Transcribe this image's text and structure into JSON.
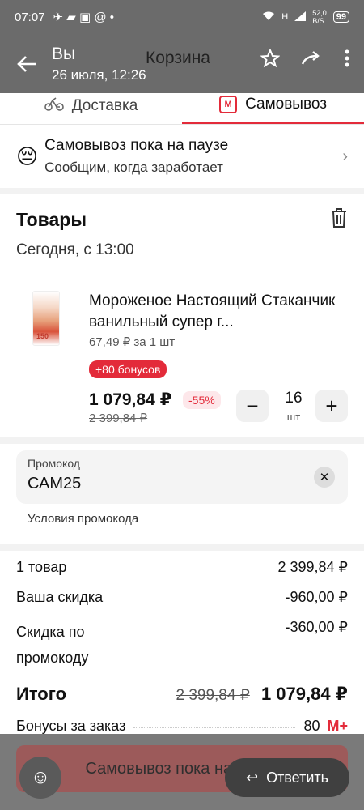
{
  "status_bar": {
    "time": "07:07",
    "net_speed_top": "52,0",
    "net_speed_bottom": "B/S",
    "battery": "99",
    "signal_label": "H"
  },
  "header": {
    "author": "Вы",
    "datetime": "26 июля, 12:26",
    "title": "Корзина"
  },
  "tabs": [
    {
      "label": "Доставка",
      "icon": "bicycle-icon"
    },
    {
      "label": "Самовывоз",
      "icon": "magnit-store-icon",
      "pill": "M"
    }
  ],
  "pause_notice": {
    "emoji": "😔",
    "title": "Самовывоз пока на паузе",
    "subtitle": "Сообщим, когда заработает"
  },
  "goods": {
    "title": "Товары",
    "time": "Сегодня, с 13:00",
    "item": {
      "name": "Мороженое Настоящий Стаканчик ванильный супер г...",
      "unit_price": "67,49 ₽ за 1 шт",
      "bonus": "+80 бонусов",
      "price": "1 079,84 ₽",
      "discount": "-55%",
      "old_price": "2 399,84 ₽",
      "qty": "16",
      "qty_unit": "шт",
      "thumb_label": "150"
    }
  },
  "promo": {
    "label": "Промокод",
    "value": "САМ25",
    "conditions": "Условия промокода"
  },
  "summary": {
    "rows": [
      {
        "label": "1 товар",
        "value": "2 399,84 ₽"
      },
      {
        "label": "Ваша скидка",
        "value": "-960,00 ₽"
      },
      {
        "label": "Скидка по промокоду",
        "value": "-360,00 ₽"
      }
    ],
    "total_label": "Итого",
    "total_old": "2 399,84 ₽",
    "total": "1 079,84 ₽",
    "bonuses_label": "Бонусы за заказ",
    "bonuses_value": "80",
    "bonuses_brand": "M+"
  },
  "bottom": {
    "pause_button": "Самовывоз пока на паузе",
    "reply": "Ответить"
  },
  "colors": {
    "accent": "#e32b3a",
    "overlay": "#6b6b6b"
  }
}
